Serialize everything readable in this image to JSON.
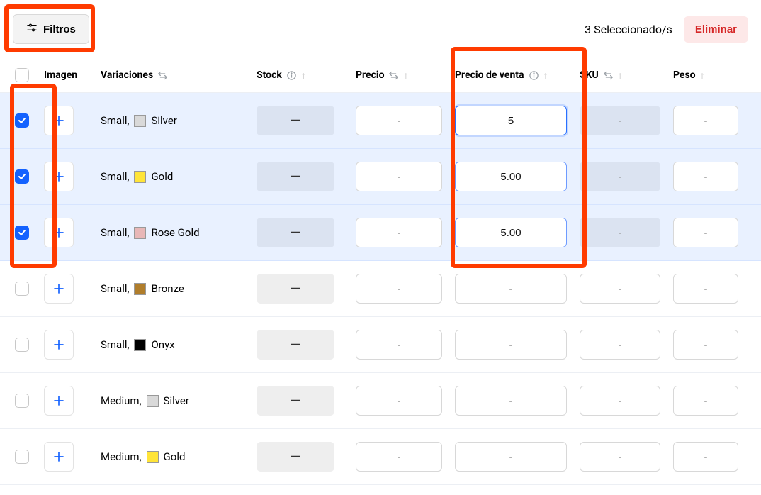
{
  "toolbar": {
    "filters_label": "Filtros",
    "selected_text": "3 Seleccionado/s",
    "delete_label": "Eliminar"
  },
  "headers": {
    "imagen": "Imagen",
    "variaciones": "Variaciones",
    "stock": "Stock",
    "precio": "Precio",
    "precio_venta": "Precio de venta",
    "sku": "SKU",
    "peso": "Peso"
  },
  "rows": [
    {
      "checked": true,
      "size": "Small",
      "color": "Silver",
      "swatch": "#d9d9d9",
      "precio": "-",
      "precio_venta": "5",
      "sku": "-",
      "peso": "-",
      "focus_primary": true
    },
    {
      "checked": true,
      "size": "Small",
      "color": "Gold",
      "swatch": "#ffe438",
      "precio": "-",
      "precio_venta": "5.00",
      "sku": "-",
      "peso": "-",
      "focus_secondary": true
    },
    {
      "checked": true,
      "size": "Small",
      "color": "Rose Gold",
      "swatch": "#e8b7b7",
      "precio": "-",
      "precio_venta": "5.00",
      "sku": "-",
      "peso": "-",
      "focus_secondary": true
    },
    {
      "checked": false,
      "size": "Small",
      "color": "Bronze",
      "swatch": "#b07d2b",
      "precio": "-",
      "precio_venta": "-",
      "sku": "-",
      "peso": "-"
    },
    {
      "checked": false,
      "size": "Small",
      "color": "Onyx",
      "swatch": "#000000",
      "precio": "-",
      "precio_venta": "-",
      "sku": "-",
      "peso": "-"
    },
    {
      "checked": false,
      "size": "Medium",
      "color": "Silver",
      "swatch": "#d9d9d9",
      "precio": "-",
      "precio_venta": "-",
      "sku": "-",
      "peso": "-"
    },
    {
      "checked": false,
      "size": "Medium",
      "color": "Gold",
      "swatch": "#ffe438",
      "precio": "-",
      "precio_venta": "-",
      "sku": "-",
      "peso": "-"
    }
  ],
  "stock_placeholder": "—",
  "comma": ","
}
